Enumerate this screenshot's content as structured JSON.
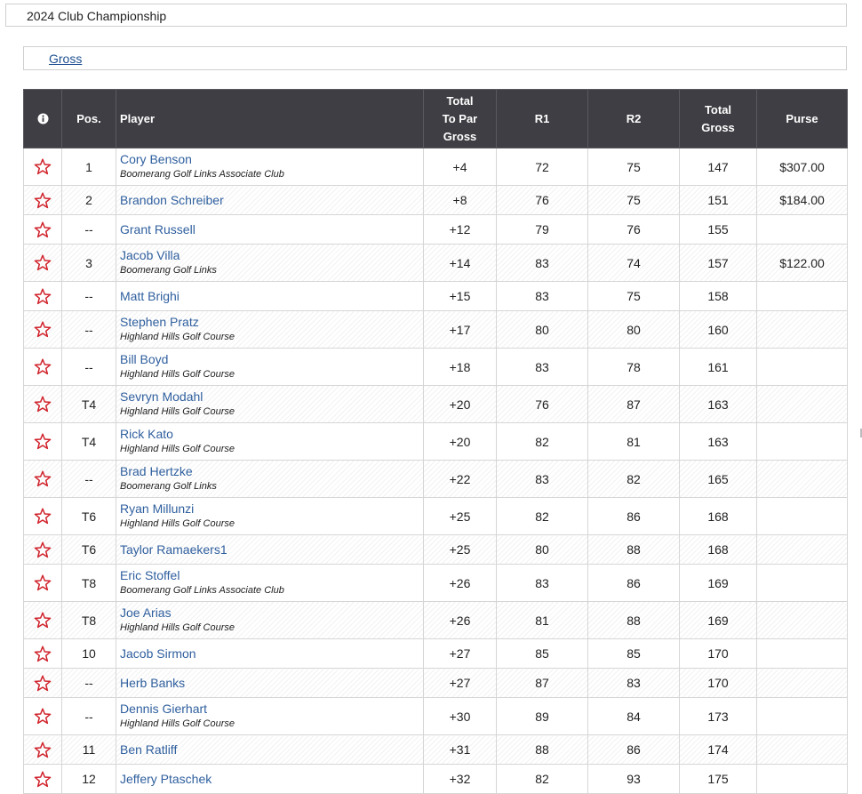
{
  "event_title": "2024 Club Championship",
  "tab_gross": "Gross",
  "headers": {
    "info": "",
    "pos": "Pos.",
    "player": "Player",
    "topar_line1": "Total",
    "topar_line2": "To Par",
    "topar_line3": "Gross",
    "r1": "R1",
    "r2": "R2",
    "total_line1": "Total",
    "total_line2": "Gross",
    "purse": "Purse"
  },
  "accent_star_color": "#d0212a",
  "rows": [
    {
      "pos": "1",
      "name": "Cory Benson",
      "club": "Boomerang Golf Links Associate Club",
      "topar": "+4",
      "r1": "72",
      "r2": "75",
      "total": "147",
      "purse": "$307.00"
    },
    {
      "pos": "2",
      "name": "Brandon Schreiber",
      "club": "",
      "topar": "+8",
      "r1": "76",
      "r2": "75",
      "total": "151",
      "purse": "$184.00"
    },
    {
      "pos": "--",
      "name": "Grant Russell",
      "club": "",
      "topar": "+12",
      "r1": "79",
      "r2": "76",
      "total": "155",
      "purse": ""
    },
    {
      "pos": "3",
      "name": "Jacob Villa",
      "club": "Boomerang Golf Links",
      "topar": "+14",
      "r1": "83",
      "r2": "74",
      "total": "157",
      "purse": "$122.00"
    },
    {
      "pos": "--",
      "name": "Matt Brighi",
      "club": "",
      "topar": "+15",
      "r1": "83",
      "r2": "75",
      "total": "158",
      "purse": ""
    },
    {
      "pos": "--",
      "name": "Stephen Pratz",
      "club": "Highland Hills Golf Course",
      "topar": "+17",
      "r1": "80",
      "r2": "80",
      "total": "160",
      "purse": ""
    },
    {
      "pos": "--",
      "name": "Bill Boyd",
      "club": "Highland Hills Golf Course",
      "topar": "+18",
      "r1": "83",
      "r2": "78",
      "total": "161",
      "purse": ""
    },
    {
      "pos": "T4",
      "name": "Sevryn Modahl",
      "club": "Highland Hills Golf Course",
      "topar": "+20",
      "r1": "76",
      "r2": "87",
      "total": "163",
      "purse": ""
    },
    {
      "pos": "T4",
      "name": "Rick Kato",
      "club": "Highland Hills Golf Course",
      "topar": "+20",
      "r1": "82",
      "r2": "81",
      "total": "163",
      "purse": ""
    },
    {
      "pos": "--",
      "name": "Brad Hertzke",
      "club": "Boomerang Golf Links",
      "topar": "+22",
      "r1": "83",
      "r2": "82",
      "total": "165",
      "purse": ""
    },
    {
      "pos": "T6",
      "name": "Ryan Millunzi",
      "club": "Highland Hills Golf Course",
      "topar": "+25",
      "r1": "82",
      "r2": "86",
      "total": "168",
      "purse": ""
    },
    {
      "pos": "T6",
      "name": "Taylor Ramaekers1",
      "club": "",
      "topar": "+25",
      "r1": "80",
      "r2": "88",
      "total": "168",
      "purse": ""
    },
    {
      "pos": "T8",
      "name": "Eric Stoffel",
      "club": "Boomerang Golf Links Associate Club",
      "topar": "+26",
      "r1": "83",
      "r2": "86",
      "total": "169",
      "purse": ""
    },
    {
      "pos": "T8",
      "name": "Joe Arias",
      "club": "Highland Hills Golf Course",
      "topar": "+26",
      "r1": "81",
      "r2": "88",
      "total": "169",
      "purse": ""
    },
    {
      "pos": "10",
      "name": "Jacob Sirmon",
      "club": "",
      "topar": "+27",
      "r1": "85",
      "r2": "85",
      "total": "170",
      "purse": ""
    },
    {
      "pos": "--",
      "name": "Herb Banks",
      "club": "",
      "topar": "+27",
      "r1": "87",
      "r2": "83",
      "total": "170",
      "purse": ""
    },
    {
      "pos": "--",
      "name": "Dennis Gierhart",
      "club": "Highland Hills Golf Course",
      "topar": "+30",
      "r1": "89",
      "r2": "84",
      "total": "173",
      "purse": ""
    },
    {
      "pos": "11",
      "name": "Ben Ratliff",
      "club": "",
      "topar": "+31",
      "r1": "88",
      "r2": "86",
      "total": "174",
      "purse": ""
    },
    {
      "pos": "12",
      "name": "Jeffery Ptaschek",
      "club": "",
      "topar": "+32",
      "r1": "82",
      "r2": "93",
      "total": "175",
      "purse": ""
    }
  ]
}
